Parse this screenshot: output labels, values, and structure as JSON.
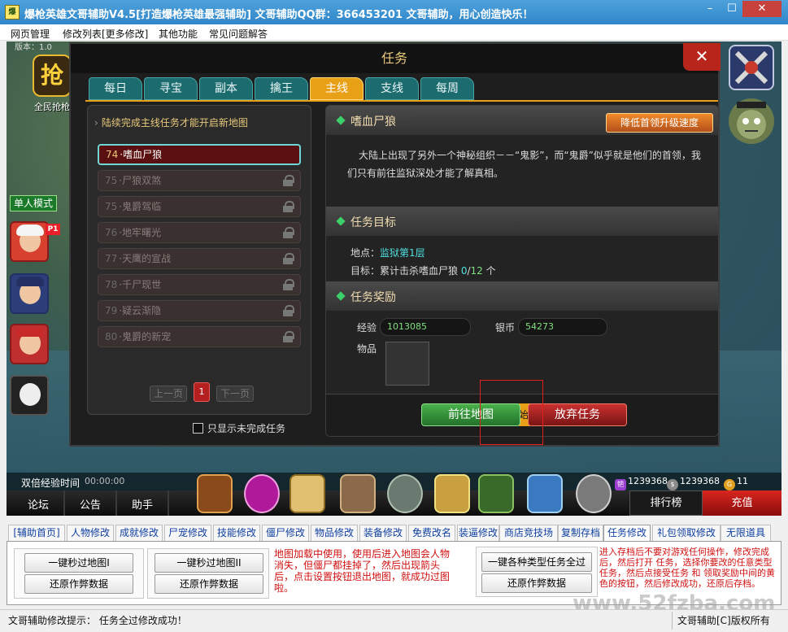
{
  "window": {
    "title": "爆枪英雄文哥辅助V4.5[打造爆枪英雄最强辅助]    文哥辅助QQ群：366453201 文哥辅助，用心创造快乐！",
    "min_glyph": "–",
    "max_glyph": "☐",
    "close_glyph": "✕"
  },
  "menu": [
    "网页管理",
    "修改列表[更多修改]",
    "其他功能",
    "常见问题解答"
  ],
  "game": {
    "version_text": "版本：1.0",
    "logo_text": "抢",
    "logo_caption": "全民抢枪",
    "single_mode": "单人模式",
    "p1_badge": "P1",
    "dialog": {
      "title": "任务",
      "close_glyph": "✕",
      "tabs": [
        "每日",
        "寻宝",
        "副本",
        "擒王",
        "主线",
        "支线",
        "每周"
      ],
      "active_tab": "主线",
      "left_header": "陆续完成主线任务才能开启新地图",
      "quests": [
        {
          "num": "74",
          "name": "嗜血尸狼"
        },
        {
          "num": "75",
          "name": "尸狼双煞"
        },
        {
          "num": "75",
          "name": "鬼爵驾临"
        },
        {
          "num": "76",
          "name": "地牢曙光"
        },
        {
          "num": "77",
          "name": "天鹰的宣战"
        },
        {
          "num": "78",
          "name": "千尸现世"
        },
        {
          "num": "79",
          "name": "疑云渐隐"
        },
        {
          "num": "80",
          "name": "鬼爵的新宠"
        }
      ],
      "quest_sep": "·",
      "pager": {
        "prev": "上一页",
        "page": "1",
        "next": "下一页"
      },
      "only_undone": "只显示未完成任务",
      "detail": {
        "quest_name": "嗜血尸狼",
        "speed_button": "降低首领升级速度",
        "description": "大陆上出现了另外一个神秘组织－－“鬼影”，而“鬼爵”似乎就是他们的首领，我们只有前往监狱深处才能了解真相。",
        "goal_header": "任务目标",
        "location_label": "地点：",
        "location_value": "监狱第1层",
        "target_label": "目标：累计击杀嗜血尸狼 ",
        "progress_done": "0",
        "progress_sep": "/",
        "progress_total": "12",
        "progress_unit": " 个",
        "reward_header": "任务奖励",
        "exp_label": "经验",
        "exp_value": "1013085",
        "silver_label": "银币",
        "silver_value": "54273",
        "item_label": "物品",
        "go_button": "前往地图",
        "middle_glyph": "始",
        "giveup_button": "放弃任务"
      }
    },
    "hud": {
      "double_exp_label": "双倍经验时间",
      "double_exp_time": "00:00:00",
      "links": [
        "论坛",
        "公告",
        "助手"
      ],
      "currency": [
        {
          "icon_text": "钯",
          "value": "1239368",
          "color": "#9b3fd0"
        },
        {
          "icon_text": "$",
          "value": "1239368",
          "color": "#8a8a8a"
        },
        {
          "icon_text": "G",
          "value": "11",
          "color": "#e0a020"
        }
      ],
      "rank_button": "排行榜",
      "charge_button": "充值"
    }
  },
  "tool_tabs": [
    "[辅助首页]",
    "人物修改",
    "成就修改",
    "尸宠修改",
    "技能修改",
    "僵尸修改",
    "物品修改",
    "装备修改",
    "免费改名",
    "装逼修改",
    "商店竞技场",
    "复制存档",
    "任务修改",
    "礼包领取修改",
    "无限道具"
  ],
  "active_tool_tab": "任务修改",
  "tool_panel": {
    "btn_map1": "一键秒过地图I",
    "btn_restore1": "还原作弊数据",
    "btn_map2": "一键秒过地图II",
    "btn_restore2": "还原作弊数据",
    "note_left": "地图加载中使用，使用后进入地图会人物消失，但僵尸都挂掉了，然后出现箭头后，点击设置按钮退出地图，就成功过图啦。",
    "btn_all_tasks": "一键各种类型任务全过",
    "btn_restore3": "还原作弊数据",
    "note_right": "进入存档后不要对游戏任何操作，修改完成后，然后打开 任务，选择你要改的任意类型任务，然后点接受任务 和 领取奖励中间的黄色的按钮，然后修改成功，还原后存档。"
  },
  "status": {
    "left": "文哥辅助修改提示：  任务全过修改成功！",
    "right": "文哥辅助[C]版权所有"
  },
  "watermark": "www.52fzba.com"
}
